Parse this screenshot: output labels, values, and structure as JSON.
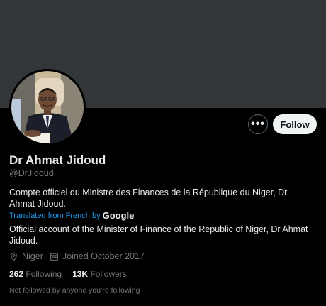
{
  "profile": {
    "name": "Dr Ahmat Jidoud",
    "handle": "@DrJidoud",
    "bio_fr": "Compte officiel du Ministre des Finances de la République du Niger, Dr Ahmat Jidoud.",
    "translated_label": "Translated from French by",
    "translator": "Google",
    "bio_en": "Official account of the Minister of Finance of the Republic of Niger, Dr Ahmat Jidoud.",
    "location": "Niger",
    "joined": "Joined October 2017",
    "following_count": "262",
    "following_label": "Following",
    "followers_count": "13K",
    "followers_label": "Followers",
    "follow_note": "Not followed by anyone you’re following"
  },
  "actions": {
    "more_glyph": "•••",
    "follow_label": "Follow"
  },
  "icons": {
    "more": "more-icon",
    "location": "location-pin-icon",
    "calendar": "calendar-icon"
  },
  "colors": {
    "background": "#000000",
    "banner": "#333639",
    "accent": "#1d9bf0",
    "muted": "#71767b",
    "follow_button": "#eff3f4"
  }
}
